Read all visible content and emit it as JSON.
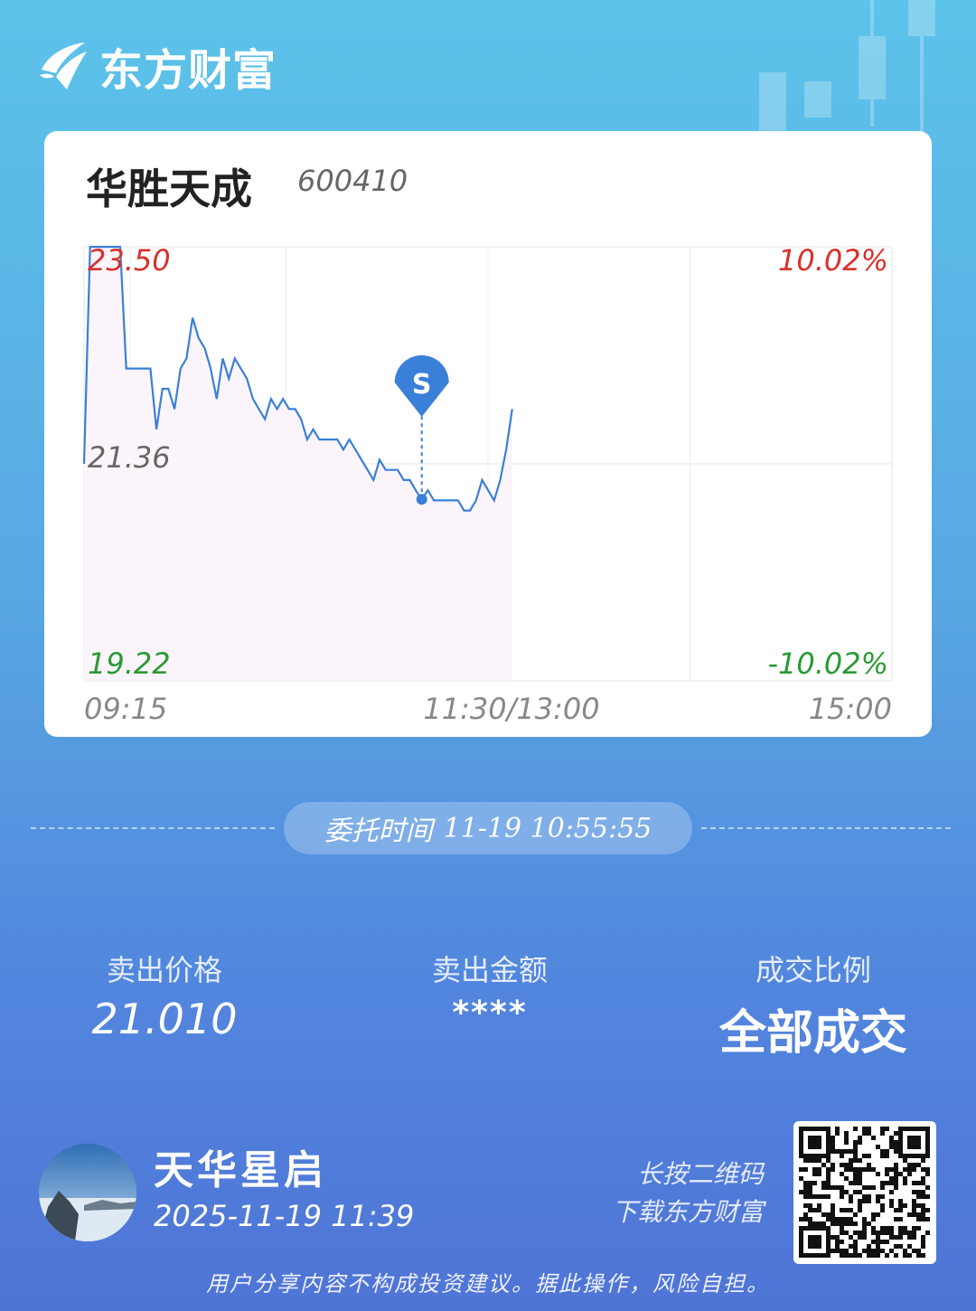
{
  "brand": {
    "name": "东方财富"
  },
  "stock": {
    "name": "华胜天成",
    "code": "600410"
  },
  "chart_data": {
    "type": "line",
    "x_ticks": [
      "09:15",
      "11:30/13:00",
      "15:00"
    ],
    "y_left_labels": {
      "top": "23.50",
      "mid": "21.36",
      "bottom": "19.22"
    },
    "y_right_labels": {
      "top": "10.02%",
      "bottom": "-10.02%"
    },
    "ylim": [
      19.22,
      23.5
    ],
    "prev_close": 21.36,
    "marker": {
      "label": "S",
      "time_index": 56,
      "price": 21.01
    },
    "series": [
      {
        "values": [
          21.36,
          23.5,
          23.5,
          23.5,
          23.5,
          23.5,
          23.5,
          22.3,
          22.3,
          22.3,
          22.3,
          22.3,
          21.7,
          22.1,
          22.1,
          21.9,
          22.3,
          22.4,
          22.8,
          22.6,
          22.5,
          22.3,
          22.0,
          22.4,
          22.2,
          22.4,
          22.3,
          22.2,
          22.0,
          21.9,
          21.8,
          22.0,
          21.9,
          22.0,
          21.9,
          21.9,
          21.8,
          21.6,
          21.7,
          21.6,
          21.6,
          21.6,
          21.6,
          21.5,
          21.6,
          21.5,
          21.4,
          21.3,
          21.2,
          21.4,
          21.3,
          21.3,
          21.3,
          21.2,
          21.2,
          21.1,
          21.01,
          21.1,
          21.0,
          21.0,
          21.0,
          21.0,
          21.0,
          20.9,
          20.9,
          21.0,
          21.2,
          21.1,
          21.0,
          21.2,
          21.5,
          21.9
        ]
      }
    ],
    "colors": {
      "line": "#3a7fd8",
      "up": "#d9302c",
      "down": "#2a9a33",
      "neutral": "#666666"
    }
  },
  "order": {
    "label": "委托时间",
    "time": "11-19 10:55:55"
  },
  "stats": [
    {
      "label": "卖出价格",
      "value": "21.010"
    },
    {
      "label": "卖出金额",
      "value": "****"
    },
    {
      "label": "成交比例",
      "value": "全部成交"
    }
  ],
  "user": {
    "name": "天华星启",
    "time": "2025-11-19 11:39"
  },
  "qr_hint": {
    "line1": "长按二维码",
    "line2": "下载东方财富"
  },
  "disclaimer": "用户分享内容不构成投资建议。据此操作，风险自担。"
}
